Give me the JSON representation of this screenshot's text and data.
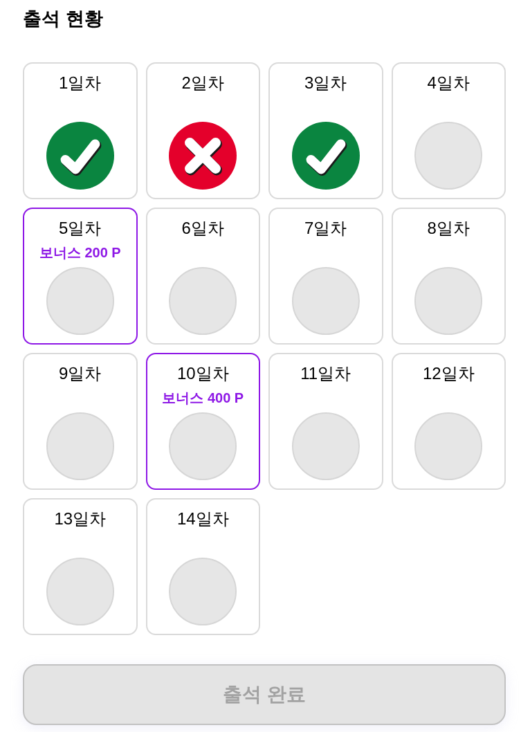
{
  "title": "출석 현황",
  "days": [
    {
      "label": "1일차",
      "kind": "check"
    },
    {
      "label": "2일차",
      "kind": "cross"
    },
    {
      "label": "3일차",
      "kind": "check"
    },
    {
      "label": "4일차",
      "kind": "empty"
    },
    {
      "label": "5일차",
      "kind": "empty",
      "bonus": "보너스 200 P"
    },
    {
      "label": "6일차",
      "kind": "empty"
    },
    {
      "label": "7일차",
      "kind": "empty"
    },
    {
      "label": "8일차",
      "kind": "empty"
    },
    {
      "label": "9일차",
      "kind": "empty"
    },
    {
      "label": "10일차",
      "kind": "empty",
      "bonus": "보너스 400 P"
    },
    {
      "label": "11일차",
      "kind": "empty"
    },
    {
      "label": "12일차",
      "kind": "empty"
    },
    {
      "label": "13일차",
      "kind": "empty"
    },
    {
      "label": "14일차",
      "kind": "empty"
    }
  ],
  "button": {
    "label": "출석 완료",
    "disabled": true
  }
}
